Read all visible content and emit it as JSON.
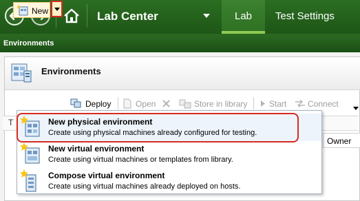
{
  "header": {
    "title": "Lab Center",
    "tabs": [
      {
        "label": "Lab",
        "active": true
      },
      {
        "label": "Test Settings",
        "active": false
      }
    ],
    "icons": {
      "back": "back-arrow-icon",
      "forward": "forward-arrow-icon",
      "home": "home-icon",
      "menu": "dropdown-caret-icon"
    }
  },
  "breadcrumb": {
    "label": "Environments"
  },
  "panel": {
    "title": "Environments",
    "icon": "environments-icon"
  },
  "toolbar": {
    "new_label": "New",
    "deploy_label": "Deploy",
    "open_label": "Open",
    "store_label": "Store in library",
    "start_label": "Start",
    "connect_label": "Connect"
  },
  "grid": {
    "first_col_letter": "T",
    "owner_label": "Owner"
  },
  "menu": {
    "items": [
      {
        "title": "New physical environment",
        "desc": "Create using physical machines already configured for testing.",
        "icon": "physical-environment-icon"
      },
      {
        "title": "New virtual environment",
        "desc": "Create using virtual machines or templates from library.",
        "icon": "virtual-environment-icon"
      },
      {
        "title": "Compose virtual environment",
        "desc": "Create using virtual machines already deployed on hosts.",
        "icon": "compose-environment-icon"
      }
    ]
  },
  "colors": {
    "header_green": "#2b6e22",
    "accent_green": "#8fcb53",
    "highlight_red": "#d82a20"
  }
}
